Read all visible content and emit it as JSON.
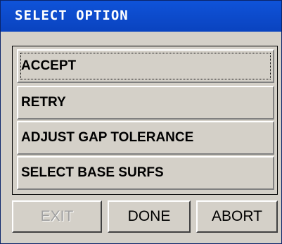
{
  "window": {
    "title": "SELECT OPTION"
  },
  "options": [
    {
      "label": "ACCEPT"
    },
    {
      "label": "RETRY"
    },
    {
      "label": "ADJUST GAP TOLERANCE"
    },
    {
      "label": "SELECT BASE SURFS"
    }
  ],
  "buttons": {
    "exit": {
      "label": "EXIT",
      "enabled": false
    },
    "done": {
      "label": "DONE",
      "enabled": true
    },
    "abort": {
      "label": "ABORT",
      "enabled": true
    }
  },
  "colors": {
    "titlebar": "#0a43bf",
    "face": "#d4d0c8",
    "disabled_text": "#a0a0a0"
  }
}
